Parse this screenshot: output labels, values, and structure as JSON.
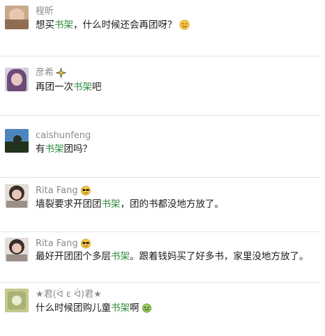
{
  "comments": [
    {
      "name": "程昕",
      "badge": "",
      "msg_before": "想买",
      "keyword": "书架",
      "msg_after": "，什么时候还会再团呀？",
      "emoji": "smile-emoji"
    },
    {
      "name": "彦希",
      "badge": "sparkle-badge",
      "msg_before": "再团一次",
      "keyword": "书架",
      "msg_after": "吧",
      "emoji": ""
    },
    {
      "name": "caishunfeng",
      "badge": "",
      "msg_before": "有",
      "keyword": "书架",
      "msg_after": "团吗？",
      "emoji": ""
    },
    {
      "name": "Rita Fang",
      "badge": "sunglasses-badge",
      "msg_before": "墙裂要求开团团",
      "keyword": "书架",
      "msg_after": "，团的书都没地方放了。",
      "emoji": ""
    },
    {
      "name": "Rita Fang",
      "badge": "sunglasses-badge",
      "msg_before": "最好开团团个多层",
      "keyword": "书架",
      "msg_after": "。跟着钱妈买了好多书，家里没地方放了。",
      "emoji": ""
    },
    {
      "name": "★君(ᐛ ε ᐛ)君★",
      "badge": "",
      "msg_before": "什么时候团购儿童",
      "keyword": "书架",
      "msg_after": "啊",
      "emoji": "crying-face-emoji"
    }
  ],
  "colors": {
    "keyword": "#2e8b3a",
    "name": "#8a8a8a",
    "text": "#1a1a1a",
    "divider": "#e3e3e3"
  }
}
